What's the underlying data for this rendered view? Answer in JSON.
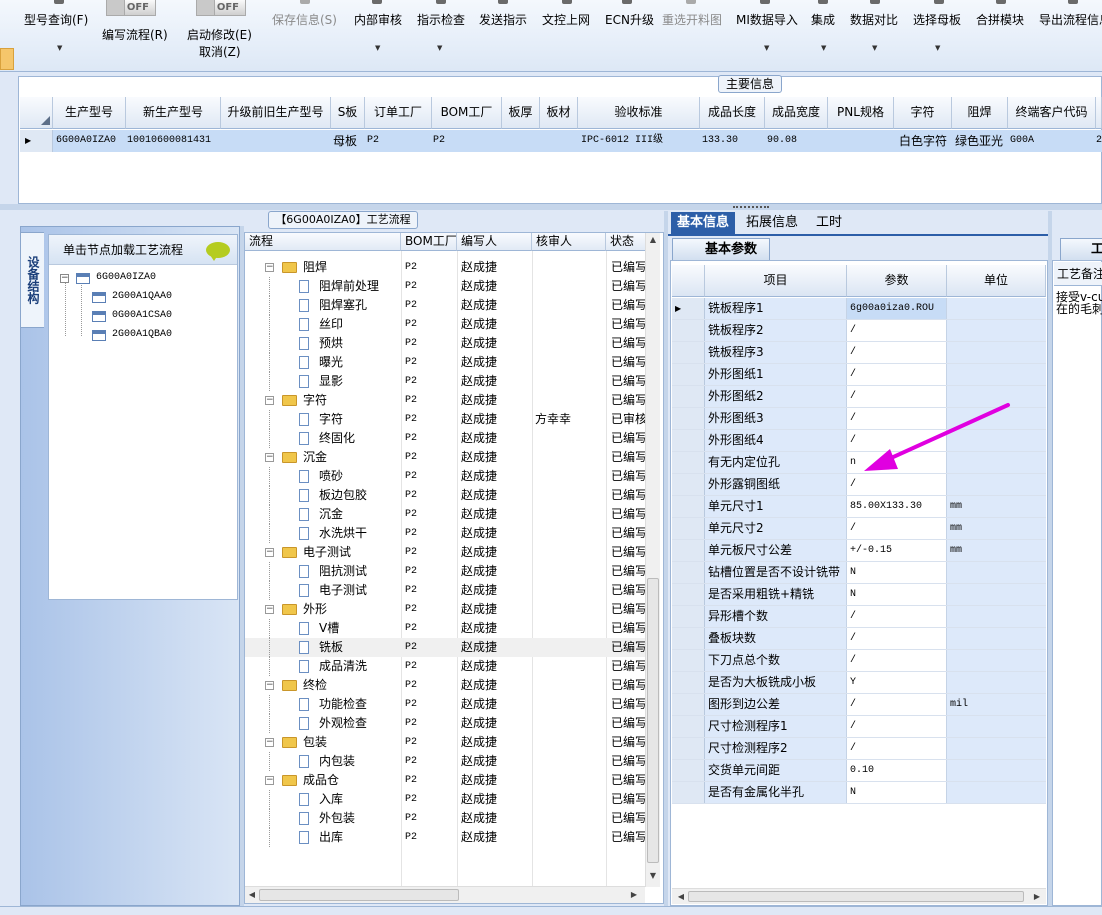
{
  "toolbar": {
    "items": [
      {
        "label": "型号查询(F)",
        "dropdown": true
      },
      {
        "label": "编写流程(R)"
      },
      {
        "label": "启动修改(E)",
        "label2": "取消(Z)"
      },
      {
        "label": "保存信息(S)",
        "disabled": true
      },
      {
        "label": "内部审核",
        "dropdown": true
      },
      {
        "label": "指示检查",
        "dropdown": true
      },
      {
        "label": "发送指示"
      },
      {
        "label": "文控上网"
      },
      {
        "label": "ECN升级"
      },
      {
        "label": "重选开料图",
        "disabled": true
      },
      {
        "label": "MI数据导入",
        "dropdown": true
      },
      {
        "label": "集成",
        "dropdown": true
      },
      {
        "label": "数据对比",
        "dropdown": true
      },
      {
        "label": "选择母板",
        "dropdown": true
      },
      {
        "label": "合拼模块"
      },
      {
        "label": "导出流程信息"
      }
    ],
    "toggle1": "OFF",
    "toggle2": "OFF"
  },
  "main_info": {
    "title": "主要信息",
    "columns": [
      "生产型号",
      "新生产型号",
      "升级前旧生产型号",
      "S板",
      "订单工厂",
      "BOM工厂",
      "板厚",
      "板材",
      "验收标准",
      "成品长度",
      "成品宽度",
      "PNL规格",
      "字符",
      "阻焊",
      "终端客户代码"
    ],
    "row": [
      "6G00A0IZA0",
      "10010600081431",
      "",
      "母板",
      "P2",
      "P2",
      "",
      "",
      "IPC-6012 III级",
      "133.30",
      "90.08",
      "",
      "白色字符",
      "绿色亚光",
      "G00A"
    ],
    "row_tail": "2"
  },
  "left_panel": {
    "vtab": "设备结构",
    "header": "单击节点加载工艺流程",
    "root": "6G00A0IZA0",
    "children": [
      "2G00A1QAA0",
      "0G00A1CSA0",
      "2G00A1QBA0"
    ]
  },
  "process": {
    "title": "【6G00A0IZA0】工艺流程",
    "columns": [
      "流程",
      "BOM工厂",
      "编写人",
      "核审人",
      "状态"
    ],
    "rows": [
      {
        "level": 1,
        "name": "阻焊",
        "bom": "P2",
        "writer": "赵成捷",
        "reviewer": "",
        "status": "已编写"
      },
      {
        "level": 2,
        "name": "阻焊前处理",
        "bom": "P2",
        "writer": "赵成捷",
        "reviewer": "",
        "status": "已编写"
      },
      {
        "level": 2,
        "name": "阻焊塞孔",
        "bom": "P2",
        "writer": "赵成捷",
        "reviewer": "",
        "status": "已编写"
      },
      {
        "level": 2,
        "name": "丝印",
        "bom": "P2",
        "writer": "赵成捷",
        "reviewer": "",
        "status": "已编写"
      },
      {
        "level": 2,
        "name": "预烘",
        "bom": "P2",
        "writer": "赵成捷",
        "reviewer": "",
        "status": "已编写"
      },
      {
        "level": 2,
        "name": "曝光",
        "bom": "P2",
        "writer": "赵成捷",
        "reviewer": "",
        "status": "已编写"
      },
      {
        "level": 2,
        "name": "显影",
        "bom": "P2",
        "writer": "赵成捷",
        "reviewer": "",
        "status": "已编写"
      },
      {
        "level": 1,
        "name": "字符",
        "bom": "P2",
        "writer": "赵成捷",
        "reviewer": "",
        "status": "已编写"
      },
      {
        "level": 2,
        "name": "字符",
        "bom": "P2",
        "writer": "赵成捷",
        "reviewer": "方幸幸",
        "status": "已审核"
      },
      {
        "level": 2,
        "name": "终固化",
        "bom": "P2",
        "writer": "赵成捷",
        "reviewer": "",
        "status": "已编写"
      },
      {
        "level": 1,
        "name": "沉金",
        "bom": "P2",
        "writer": "赵成捷",
        "reviewer": "",
        "status": "已编写"
      },
      {
        "level": 2,
        "name": "喷砂",
        "bom": "P2",
        "writer": "赵成捷",
        "reviewer": "",
        "status": "已编写"
      },
      {
        "level": 2,
        "name": "板边包胶",
        "bom": "P2",
        "writer": "赵成捷",
        "reviewer": "",
        "status": "已编写"
      },
      {
        "level": 2,
        "name": "沉金",
        "bom": "P2",
        "writer": "赵成捷",
        "reviewer": "",
        "status": "已编写"
      },
      {
        "level": 2,
        "name": "水洗烘干",
        "bom": "P2",
        "writer": "赵成捷",
        "reviewer": "",
        "status": "已编写"
      },
      {
        "level": 1,
        "name": "电子测试",
        "bom": "P2",
        "writer": "赵成捷",
        "reviewer": "",
        "status": "已编写"
      },
      {
        "level": 2,
        "name": "阻抗测试",
        "bom": "P2",
        "writer": "赵成捷",
        "reviewer": "",
        "status": "已编写"
      },
      {
        "level": 2,
        "name": "电子测试",
        "bom": "P2",
        "writer": "赵成捷",
        "reviewer": "",
        "status": "已编写"
      },
      {
        "level": 1,
        "name": "外形",
        "bom": "P2",
        "writer": "赵成捷",
        "reviewer": "",
        "status": "已编写"
      },
      {
        "level": 2,
        "name": "V槽",
        "bom": "P2",
        "writer": "赵成捷",
        "reviewer": "",
        "status": "已编写"
      },
      {
        "level": 2,
        "name": "铣板",
        "bom": "P2",
        "writer": "赵成捷",
        "reviewer": "",
        "status": "已编写",
        "selected": true
      },
      {
        "level": 2,
        "name": "成品清洗",
        "bom": "P2",
        "writer": "赵成捷",
        "reviewer": "",
        "status": "已编写"
      },
      {
        "level": 1,
        "name": "终检",
        "bom": "P2",
        "writer": "赵成捷",
        "reviewer": "",
        "status": "已编写"
      },
      {
        "level": 2,
        "name": "功能检查",
        "bom": "P2",
        "writer": "赵成捷",
        "reviewer": "",
        "status": "已编写"
      },
      {
        "level": 2,
        "name": "外观检查",
        "bom": "P2",
        "writer": "赵成捷",
        "reviewer": "",
        "status": "已编写"
      },
      {
        "level": 1,
        "name": "包装",
        "bom": "P2",
        "writer": "赵成捷",
        "reviewer": "",
        "status": "已编写"
      },
      {
        "level": 2,
        "name": "内包装",
        "bom": "P2",
        "writer": "赵成捷",
        "reviewer": "",
        "status": "已编写"
      },
      {
        "level": 1,
        "name": "成品仓",
        "bom": "P2",
        "writer": "赵成捷",
        "reviewer": "",
        "status": "已编写"
      },
      {
        "level": 2,
        "name": "入库",
        "bom": "P2",
        "writer": "赵成捷",
        "reviewer": "",
        "status": "已编写"
      },
      {
        "level": 2,
        "name": "外包装",
        "bom": "P2",
        "writer": "赵成捷",
        "reviewer": "",
        "status": "已编写"
      },
      {
        "level": 2,
        "name": "出库",
        "bom": "P2",
        "writer": "赵成捷",
        "reviewer": "",
        "status": "已编写"
      }
    ]
  },
  "right_panel": {
    "tabs": [
      "基本信息",
      "拓展信息",
      "工时"
    ],
    "subtab": "基本参数",
    "columns": [
      "项目",
      "参数",
      "单位"
    ],
    "rows": [
      [
        "铣板程序1",
        "6g00a0iza0.ROU",
        ""
      ],
      [
        "铣板程序2",
        "/",
        ""
      ],
      [
        "铣板程序3",
        "/",
        ""
      ],
      [
        "外形图纸1",
        "/",
        ""
      ],
      [
        "外形图纸2",
        "/",
        ""
      ],
      [
        "外形图纸3",
        "/",
        ""
      ],
      [
        "外形图纸4",
        "/",
        ""
      ],
      [
        "有无内定位孔",
        "n",
        ""
      ],
      [
        "外形露铜图纸",
        "/",
        ""
      ],
      [
        "单元尺寸1",
        "85.00X133.30",
        "mm"
      ],
      [
        "单元尺寸2",
        "/",
        "mm"
      ],
      [
        "单元板尺寸公差",
        "+/-0.15",
        "mm"
      ],
      [
        "钻槽位置是否不设计铣带",
        "N",
        ""
      ],
      [
        "是否采用粗铣+精铣",
        "N",
        ""
      ],
      [
        "异形槽个数",
        "/",
        ""
      ],
      [
        "叠板块数",
        "/",
        ""
      ],
      [
        "下刀点总个数",
        "/",
        ""
      ],
      [
        "是否为大板铣成小板",
        "Y",
        ""
      ],
      [
        "图形到边公差",
        "/",
        "mil"
      ],
      [
        "尺寸检测程序1",
        "/",
        ""
      ],
      [
        "尺寸检测程序2",
        "/",
        ""
      ],
      [
        "交货单元间距",
        "0.10",
        ""
      ],
      [
        "是否有金属化半孔",
        "N",
        ""
      ]
    ]
  },
  "far_right": {
    "tab": "工",
    "label": "工艺备注",
    "text1": "接受v-cut",
    "text2": "在的毛刺"
  },
  "annotation": {
    "arrow_color": "#e000e0"
  }
}
